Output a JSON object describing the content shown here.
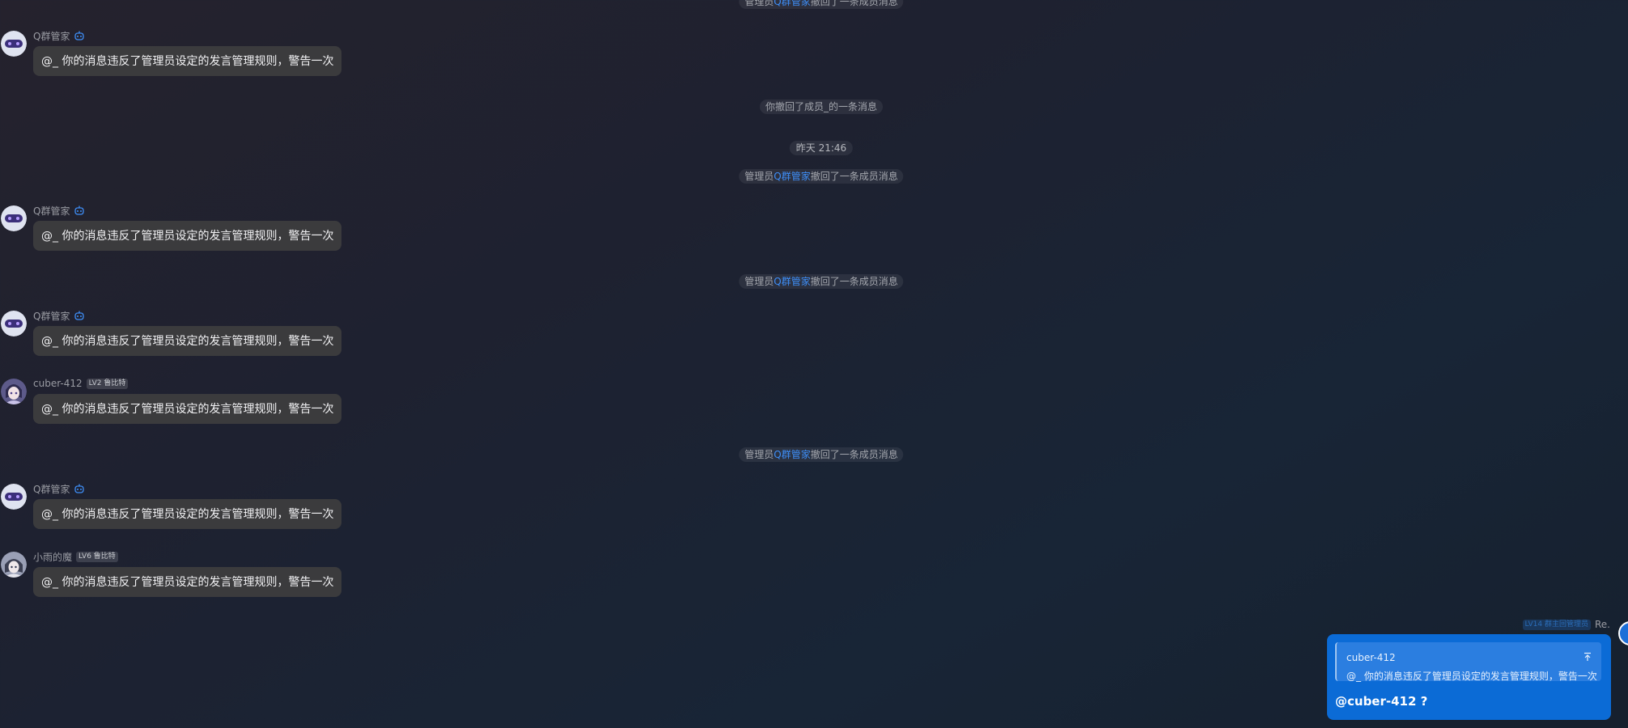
{
  "notices": {
    "n0": {
      "prefix": "管理员",
      "admin": "Q群管家",
      "suffix": "撤回了一条成员消息"
    },
    "n1": {
      "text": "你撤回了成员_的一条消息"
    },
    "time1": "昨天 21:46",
    "n2": {
      "prefix": "管理员",
      "admin": "Q群管家",
      "suffix": "撤回了一条成员消息"
    },
    "n3": {
      "prefix": "管理员",
      "admin": "Q群管家",
      "suffix": "撤回了一条成员消息"
    },
    "n4": {
      "prefix": "管理员",
      "admin": "Q群管家",
      "suffix": "撤回了一条成员消息"
    }
  },
  "messages": [
    {
      "sender": "Q群管家",
      "badge": "",
      "text": "@_ 你的消息违反了管理员设定的发言管理规则，警告一次",
      "avatar": "robot-avatar-icon",
      "bot_icon": "robot-icon"
    },
    {
      "sender": "Q群管家",
      "badge": "",
      "text": "@_ 你的消息违反了管理员设定的发言管理规则，警告一次",
      "avatar": "robot-avatar-icon",
      "bot_icon": "robot-icon"
    },
    {
      "sender": "Q群管家",
      "badge": "",
      "text": "@_ 你的消息违反了管理员设定的发言管理规则，警告一次",
      "avatar": "robot-avatar-icon",
      "bot_icon": "robot-icon"
    },
    {
      "sender": "cuber-412",
      "badge": "LV2 鲁比特",
      "text": "@_ 你的消息违反了管理员设定的发言管理规则，警告一次",
      "avatar": "anime-avatar-icon"
    },
    {
      "sender": "Q群管家",
      "badge": "",
      "text": "@_ 你的消息违反了管理员设定的发言管理规则，警告一次",
      "avatar": "robot-avatar-icon",
      "bot_icon": "robot-icon"
    },
    {
      "sender": "小雨的魔",
      "badge": "LV6 鲁比特",
      "text": "@_ 你的消息违反了管理员设定的发言管理规则，警告一次",
      "avatar": "anime-avatar-icon"
    }
  ],
  "own_message": {
    "badge": "LV14 群主回管理员",
    "name": "Re.",
    "quote_author": "cuber-412",
    "quote_text": "@_ 你的消息违反了管理员设定的发言管理规则，警告一次",
    "text": "@cuber-412 ?",
    "quote_icon": "jump-to-top-icon"
  },
  "colors": {
    "background": "#1e2130",
    "bubble": "#3b3b3d",
    "own_bubble": "#0b6bd6",
    "admin_link": "#3e8ef7"
  }
}
